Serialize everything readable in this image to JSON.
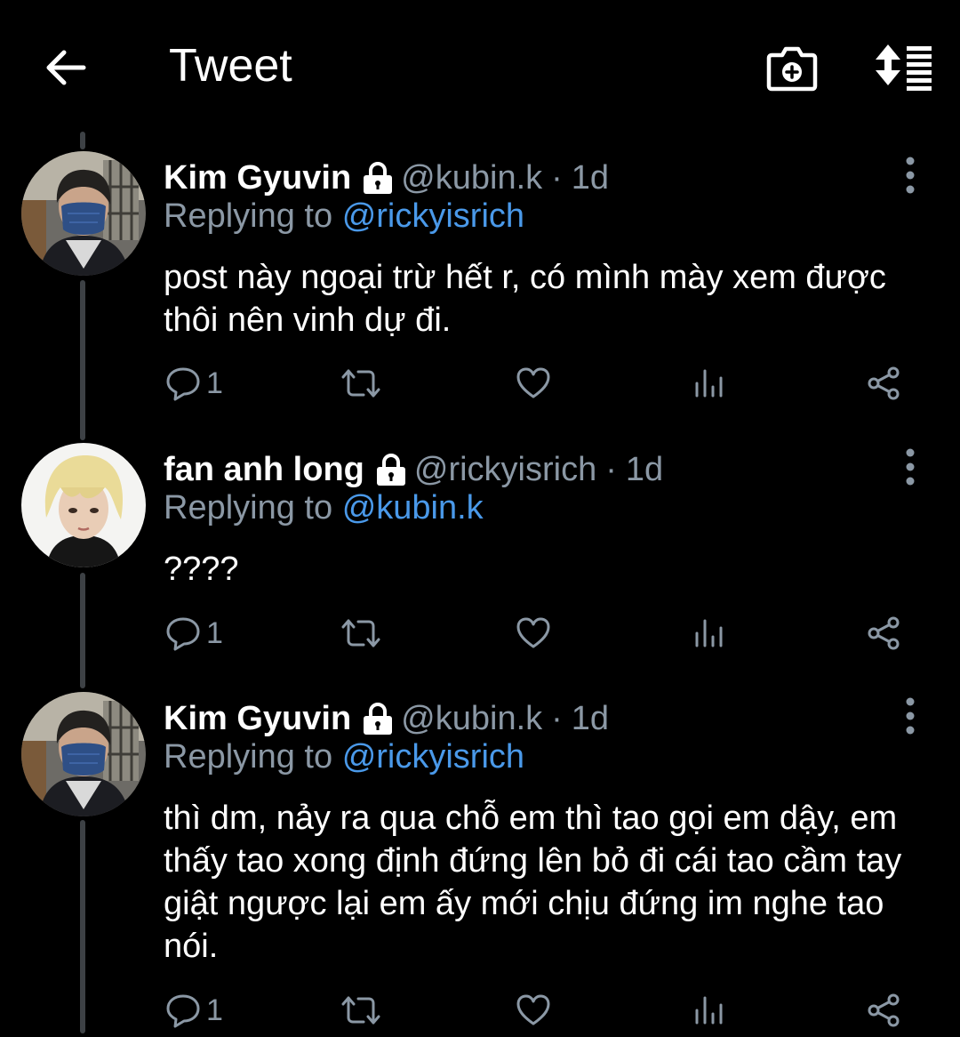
{
  "header": {
    "title": "Tweet",
    "back_icon": "arrow-left-icon",
    "camera_icon": "add-camera-icon",
    "sort_icon": "sort-list-icon"
  },
  "colors": {
    "background": "#000000",
    "text_primary": "#ffffff",
    "text_secondary": "#8b98a5",
    "link": "#4a99e9",
    "thread_line": "#3d4145"
  },
  "tweets": [
    {
      "name": "Kim Gyuvin",
      "handle": "@kubin.k",
      "separator": "·",
      "time": "1d",
      "reply_prefix": "Replying to",
      "reply_to": "@rickyisrich",
      "text": "post này ngoại trừ hết r, có mình mày xem được thôi nên vinh dự đi.",
      "reply_count": "1",
      "avatar": "masked-young-man-avatar"
    },
    {
      "name": "fan anh long",
      "handle": "@rickyisrich",
      "separator": "·",
      "time": "1d",
      "reply_prefix": "Replying to",
      "reply_to": "@kubin.k",
      "text": "????",
      "reply_count": "1",
      "avatar": "blonde-person-avatar"
    },
    {
      "name": "Kim Gyuvin",
      "handle": "@kubin.k",
      "separator": "·",
      "time": "1d",
      "reply_prefix": "Replying to",
      "reply_to": "@rickyisrich",
      "text": "thì dm, nảy ra qua chỗ em thì tao gọi em dậy, em thấy tao xong định đứng lên bỏ đi cái tao cầm tay giật ngược lại em ấy mới chịu đứng im nghe tao nói.",
      "reply_count": "1",
      "avatar": "masked-young-man-avatar"
    }
  ]
}
